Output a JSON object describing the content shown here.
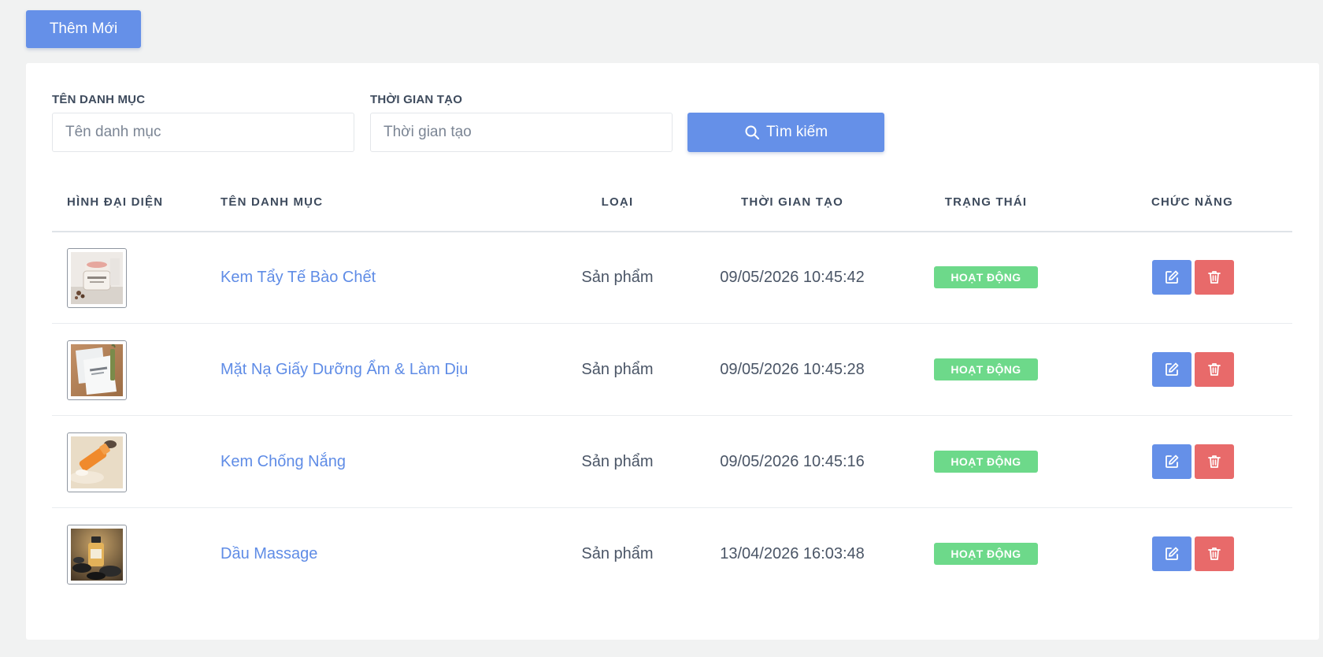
{
  "toolbar": {
    "add_label": "Thêm Mới"
  },
  "filters": {
    "name_label": "TÊN DANH MỤC",
    "name_placeholder": "Tên danh mục",
    "time_label": "THỜI GIAN TẠO",
    "time_placeholder": "Thời gian tạo",
    "search_label": "Tìm kiếm"
  },
  "table": {
    "headers": {
      "image": "HÌNH ĐẠI DIỆN",
      "name": "TÊN DANH MỤC",
      "type": "LOẠI",
      "created": "THỜI GIAN TẠO",
      "status": "TRẠNG THÁI",
      "actions": "CHỨC NĂNG"
    },
    "rows": [
      {
        "name": "Kem Tẩy Tế Bào Chết",
        "type": "Sản phẩm",
        "created": "09/05/2026 10:45:42",
        "status": "HOẠT ĐỘNG",
        "thumb": "scrub-jar-image"
      },
      {
        "name": "Mặt Nạ Giấy Dưỡng Ẩm & Làm Dịu",
        "type": "Sản phẩm",
        "created": "09/05/2026 10:45:28",
        "status": "HOẠT ĐỘNG",
        "thumb": "sheet-mask-image"
      },
      {
        "name": "Kem Chống Nắng",
        "type": "Sản phẩm",
        "created": "09/05/2026 10:45:16",
        "status": "HOẠT ĐỘNG",
        "thumb": "sunscreen-tube-image"
      },
      {
        "name": "Dầu Massage",
        "type": "Sản phẩm",
        "created": "13/04/2026 16:03:48",
        "status": "HOẠT ĐỘNG",
        "thumb": "massage-oil-image"
      }
    ]
  },
  "icons": {
    "search": "search-icon",
    "edit": "edit-icon",
    "delete": "trash-icon"
  },
  "colors": {
    "primary": "#6590e8",
    "danger": "#e86a6a",
    "success": "#6dd98a",
    "link": "#5f8ce6"
  }
}
